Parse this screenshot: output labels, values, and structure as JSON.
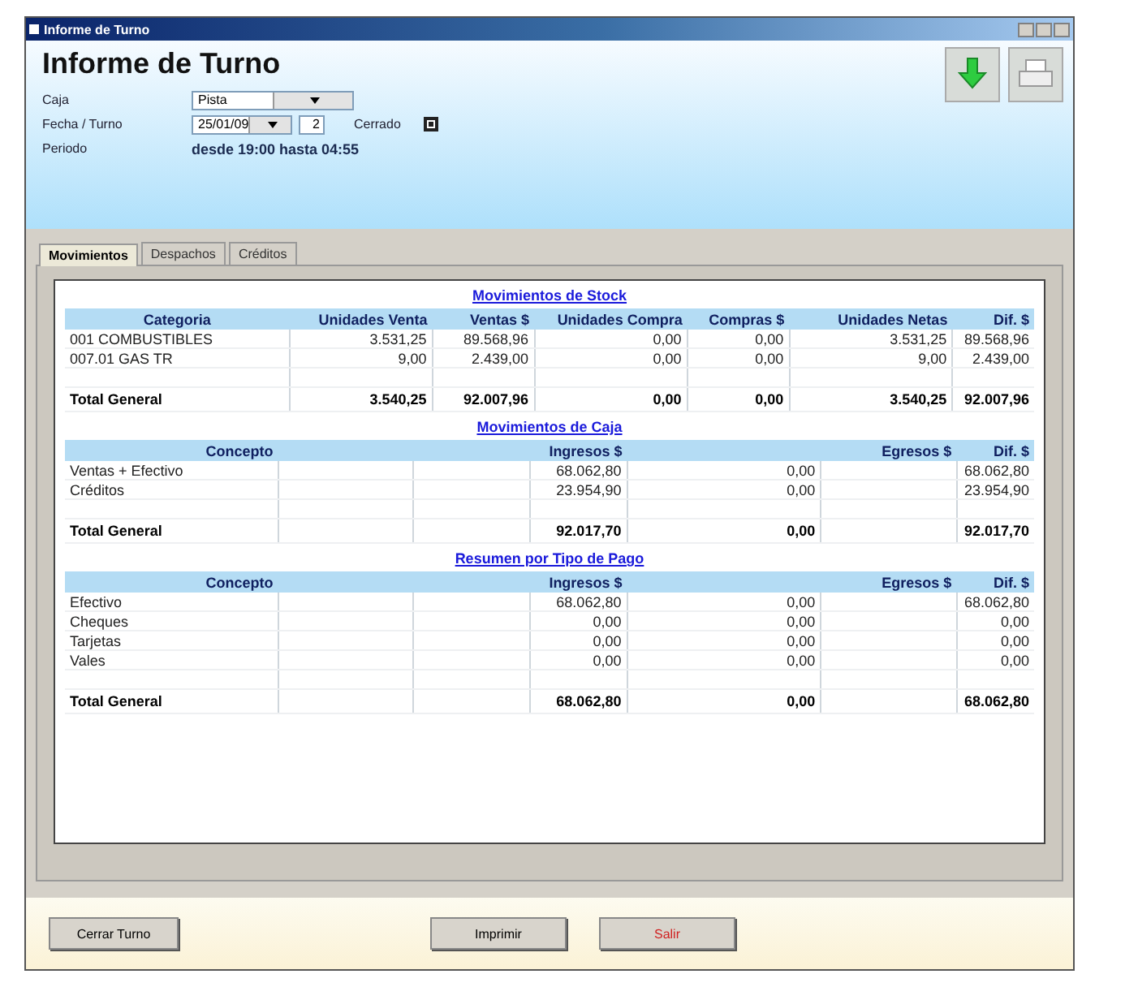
{
  "window": {
    "title": "Informe de Turno"
  },
  "header": {
    "title": "Informe de Turno",
    "fields": [
      {
        "kind": "select",
        "label": "Caja",
        "value": "Pista"
      },
      {
        "kind": "shift",
        "label": "Fecha / Turno",
        "value": "25/01/09",
        "shift": "2",
        "check_label": "Cerrado",
        "checked": true
      },
      {
        "kind": "text",
        "label": "Periodo",
        "value": "desde 19:00 hasta 04:55"
      }
    ]
  },
  "tabs": [
    {
      "label": "Movimientos",
      "selected": true
    },
    {
      "label": "Despachos",
      "selected": false
    },
    {
      "label": "Créditos",
      "selected": false
    }
  ],
  "sections": [
    {
      "title": "Movimientos de Stock",
      "kind": "wide",
      "columns": [
        "Categoria",
        "Unidades Venta",
        "Ventas $",
        "Unidades Compra",
        "Compras $",
        "Unidades Netas",
        "Dif. $"
      ],
      "rows": [
        [
          "001 COMBUSTIBLES",
          "3.531,25",
          "89.568,96",
          "0,00",
          "0,00",
          "3.531,25",
          "89.568,96"
        ],
        [
          "007.01 GAS TR",
          "9,00",
          "2.439,00",
          "0,00",
          "0,00",
          "9,00",
          "2.439,00"
        ]
      ],
      "total": [
        "Total General",
        "3.540,25",
        "92.007,96",
        "0,00",
        "0,00",
        "3.540,25",
        "92.007,96"
      ]
    },
    {
      "title": "Movimientos de Caja",
      "kind": "narrow",
      "columns": [
        "Concepto",
        "Ingresos $",
        "Egresos $",
        "Dif. $"
      ],
      "rows": [
        [
          "Ventas + Efectivo",
          "68.062,80",
          "0,00",
          "68.062,80"
        ],
        [
          "Créditos",
          "23.954,90",
          "0,00",
          "23.954,90"
        ]
      ],
      "total": [
        "Total General",
        "92.017,70",
        "0,00",
        "92.017,70"
      ]
    },
    {
      "title": "Resumen por Tipo de Pago",
      "kind": "narrow",
      "columns": [
        "Concepto",
        "Ingresos $",
        "Egresos $",
        "Dif. $"
      ],
      "rows": [
        [
          "Efectivo",
          "68.062,80",
          "0,00",
          "68.062,80"
        ],
        [
          "Cheques",
          "0,00",
          "0,00",
          "0,00"
        ],
        [
          "Tarjetas",
          "0,00",
          "0,00",
          "0,00"
        ],
        [
          "Vales",
          "0,00",
          "0,00",
          "0,00"
        ]
      ],
      "total": [
        "Total General",
        "68.062,80",
        "0,00",
        "68.062,80"
      ]
    }
  ],
  "buttons": [
    {
      "label": "Cerrar Turno",
      "kind": "normal"
    },
    {
      "label": "Imprimir",
      "kind": "normal"
    },
    {
      "label": "Salir",
      "kind": "danger"
    }
  ]
}
